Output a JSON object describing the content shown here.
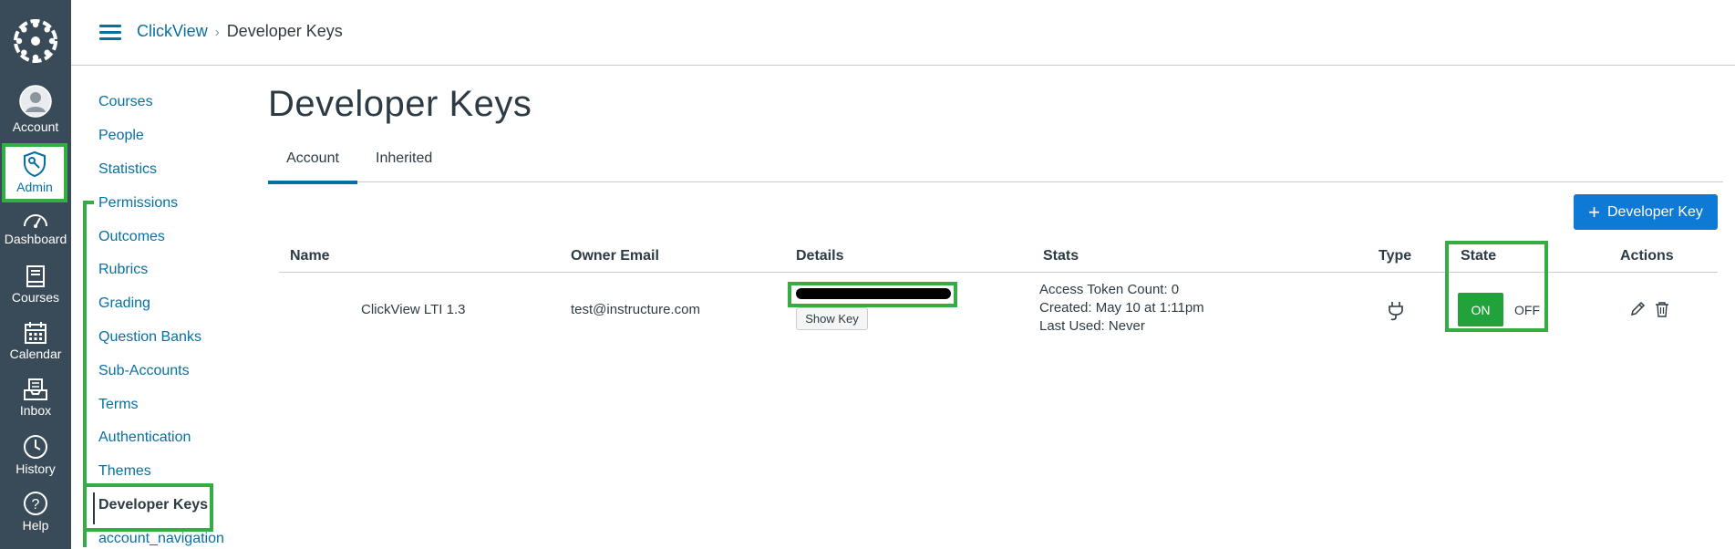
{
  "global_nav": {
    "account": "Account",
    "admin": "Admin",
    "dashboard": "Dashboard",
    "courses": "Courses",
    "calendar": "Calendar",
    "inbox": "Inbox",
    "history": "History",
    "help": "Help"
  },
  "breadcrumb": {
    "parent": "ClickView",
    "separator": "›",
    "current": "Developer Keys"
  },
  "section_nav": {
    "items": [
      "Courses",
      "People",
      "Statistics",
      "Permissions",
      "Outcomes",
      "Rubrics",
      "Grading",
      "Question Banks",
      "Sub-Accounts",
      "Terms",
      "Authentication",
      "Themes",
      "Developer Keys",
      "account_navigation"
    ]
  },
  "page": {
    "title": "Developer Keys"
  },
  "tabs": {
    "account": "Account",
    "inherited": "Inherited"
  },
  "add_button": {
    "plus": "+",
    "label": "Developer Key"
  },
  "table": {
    "headers": {
      "name": "Name",
      "owner_email": "Owner Email",
      "details": "Details",
      "stats": "Stats",
      "type": "Type",
      "state": "State",
      "actions": "Actions"
    },
    "row": {
      "name": "ClickView LTI 1.3",
      "owner_email": "test@instructure.com",
      "show_key": "Show Key",
      "stats_line1": "Access Token Count: 0",
      "stats_line2": "Created: May 10 at 1:11pm",
      "stats_line3": "Last Used: Never",
      "state_on": "ON",
      "state_off": "OFF"
    }
  },
  "colors": {
    "nav_bg": "#394b58",
    "link": "#0770a3",
    "primary": "#0e7ad6",
    "success": "#22a23a",
    "annotation": "#35ad45"
  }
}
